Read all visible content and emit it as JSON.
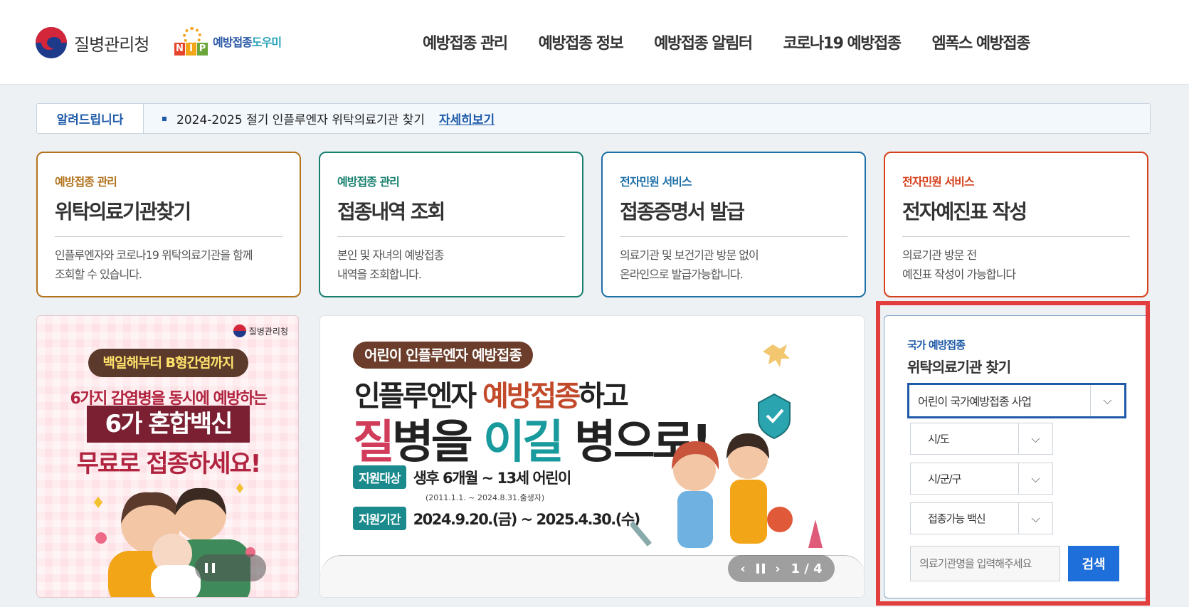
{
  "header": {
    "agency_name": "질병관리청",
    "nip_name_a": "예방접종",
    "nip_name_b": "도우미",
    "nip_letters": [
      "N",
      "I",
      "P"
    ],
    "nav": [
      "예방접종 관리",
      "예방접종 정보",
      "예방접종 알림터",
      "코로나19 예방접종",
      "엠폭스 예방접종"
    ]
  },
  "notice": {
    "title": "알려드립니다",
    "text": "2024-2025 절기 인플루엔자 위탁의료기관 찾기",
    "link": "자세히보기"
  },
  "cards": [
    {
      "category": "예방접종 관리",
      "title": "위탁의료기관찾기",
      "desc1": "인플루엔자와 코로나19 위탁의료기관을 함께",
      "desc2": "조회할 수 있습니다.",
      "color": "#b2731c"
    },
    {
      "category": "예방접종 관리",
      "title": "접종내역 조회",
      "desc1": "본인 및 자녀의 예방접종",
      "desc2": "내역을 조회합니다.",
      "color": "#17806e"
    },
    {
      "category": "전자민원 서비스",
      "title": "접종증명서 발급",
      "desc1": "의료기관 및 보건기관 방문 없이",
      "desc2": "온라인으로 발급가능합니다.",
      "color": "#1e6fa8"
    },
    {
      "category": "전자민원 서비스",
      "title": "전자예진표 작성",
      "desc1": "의료기관 방문 전",
      "desc2": "예진표 작성이 가능합니다",
      "color": "#d6401c"
    }
  ],
  "banner_left": {
    "org": "질병관리청",
    "pill": "백일해부터 B형간염까지",
    "line1": "6가지 감염병을 동시에 예방하는",
    "line2": "6가 혼합백신",
    "line3": "무료로 접종하세요!"
  },
  "banner_mid": {
    "pill": "어린이 인플루엔자 예방접종",
    "t1_a": "인플루엔자 ",
    "t1_b": "예방접종",
    "t1_c": "하고",
    "t2_a": "질",
    "t2_b": "병을 ",
    "t2_c": "이길",
    "t2_d": " 병으로!",
    "target_tag": "지원대상",
    "target_val": "생후 6개월 ~ 13세 어린이",
    "target_sub": "(2011.1.1. ~ 2024.8.31.출생자)",
    "period_tag": "지원기간",
    "period_val": "2024.9.20.(금) ~ 2025.4.30.(수)",
    "pager": "1 / 4"
  },
  "search_panel": {
    "category": "국가 예방접종",
    "title": "위탁의료기관 찾기",
    "program_select": "어린이 국가예방접종 사업",
    "sido_select": "시/도",
    "sigungu_select": "시/군/구",
    "vaccine_select": "접종가능 백신",
    "input_placeholder": "의료기관명을 입력해주세요",
    "search_button": "검색"
  },
  "colors": {
    "brand_blue": "#1e5aa8",
    "highlight_red": "#e33e3e",
    "search_button": "#1e6fd9"
  }
}
